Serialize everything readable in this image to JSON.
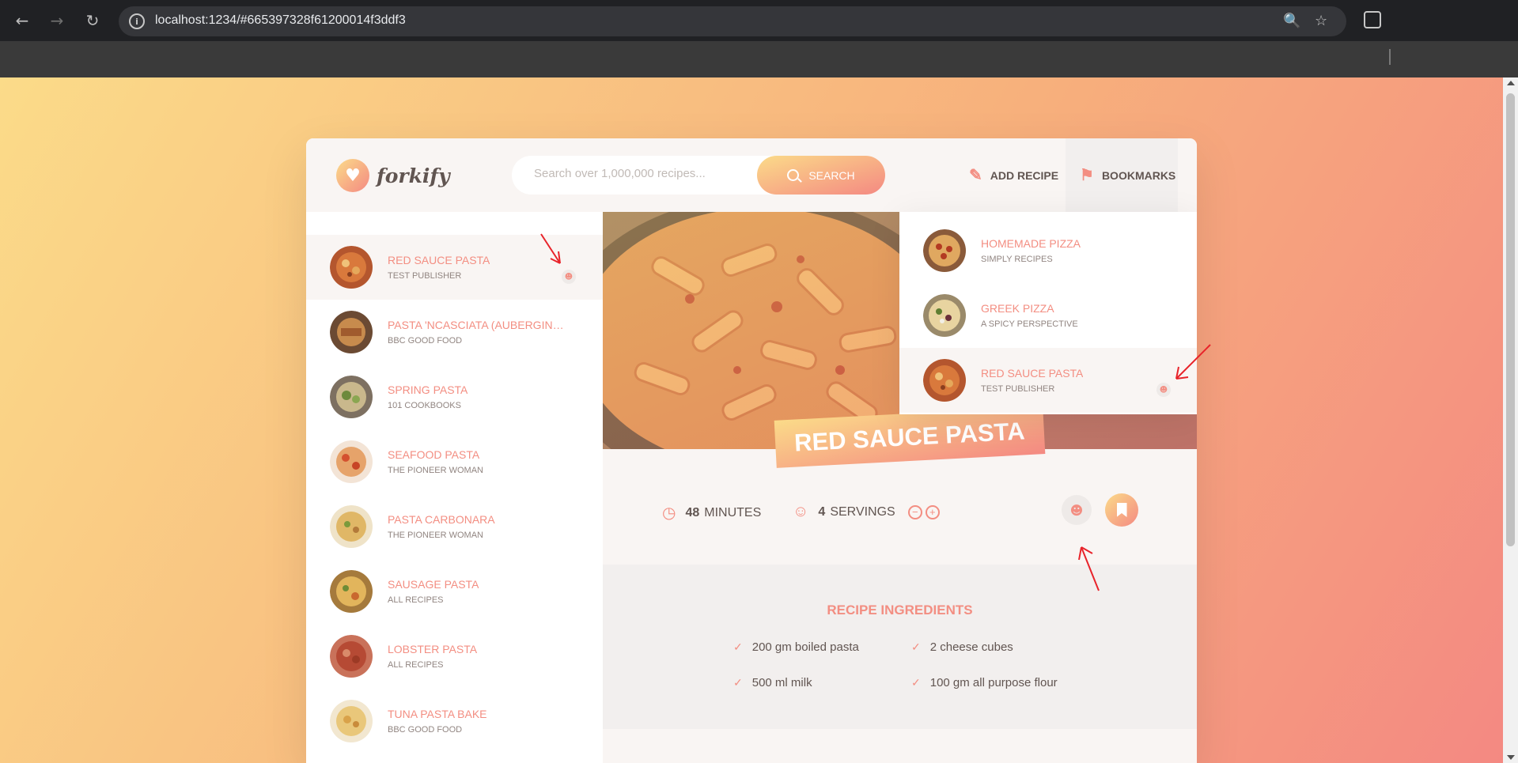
{
  "browser": {
    "url": "localhost:1234/#665397328f61200014f3ddf3",
    "back_icon": "back-arrow-icon",
    "forward_icon": "forward-arrow-icon",
    "reload_icon": "reload-icon"
  },
  "colors": {
    "accent": "#f38e82",
    "gradient_start": "#fbdb89",
    "gradient_end": "#f48982",
    "text": "#615551"
  },
  "header": {
    "logo_text": "forkify",
    "search_placeholder": "Search over 1,000,000 recipes...",
    "search_label": "SEARCH",
    "add_recipe_label": "ADD RECIPE",
    "bookmarks_label": "BOOKMARKS"
  },
  "results": [
    {
      "title": "RED SAUCE PASTA",
      "publisher": "TEST PUBLISHER",
      "user_generated": true,
      "active": true
    },
    {
      "title": "PASTA 'NCASCIATA (AUBERGINE ...",
      "publisher": "BBC GOOD FOOD"
    },
    {
      "title": "SPRING PASTA",
      "publisher": "101 COOKBOOKS"
    },
    {
      "title": "SEAFOOD PASTA",
      "publisher": "THE PIONEER WOMAN"
    },
    {
      "title": "PASTA CARBONARA",
      "publisher": "THE PIONEER WOMAN"
    },
    {
      "title": "SAUSAGE PASTA",
      "publisher": "ALL RECIPES"
    },
    {
      "title": "LOBSTER PASTA",
      "publisher": "ALL RECIPES"
    },
    {
      "title": "TUNA PASTA BAKE",
      "publisher": "BBC GOOD FOOD"
    }
  ],
  "bookmarks": [
    {
      "title": "HOMEMADE PIZZA",
      "publisher": "SIMPLY RECIPES"
    },
    {
      "title": "GREEK PIZZA",
      "publisher": "A SPICY PERSPECTIVE"
    },
    {
      "title": "RED SAUCE PASTA",
      "publisher": "TEST PUBLISHER",
      "user_generated": true,
      "active": true
    }
  ],
  "recipe": {
    "title": "RED SAUCE PASTA",
    "minutes": "48",
    "minutes_label": "MINUTES",
    "servings": "4",
    "servings_label": "SERVINGS",
    "ingredients_heading": "RECIPE INGREDIENTS",
    "ingredients": [
      "200 gm boiled pasta",
      "2 cheese cubes",
      "500 ml milk",
      "100 gm all purpose flour"
    ]
  }
}
